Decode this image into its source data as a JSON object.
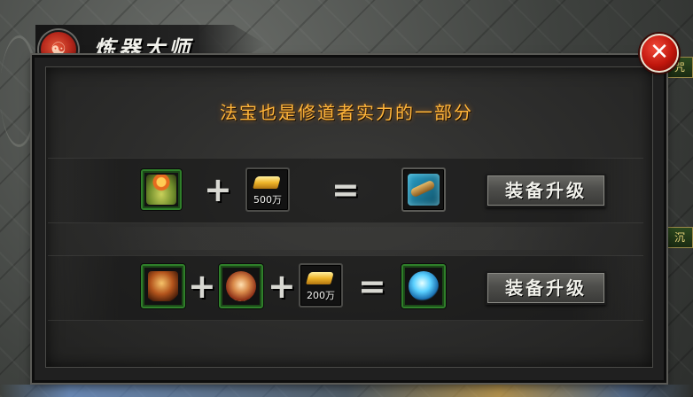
{
  "window": {
    "title": "炼器大师",
    "emblem_glyph": "☯",
    "close_glyph": "✕"
  },
  "subtitle": "法宝也是修道者实力的一部分",
  "plus_glyph": "+",
  "equals_glyph": "=",
  "recipes": [
    {
      "ingredients": [
        {
          "icon": "gourd-treasure-icon"
        },
        {
          "icon": "gold-ingot-icon",
          "label": "500万"
        }
      ],
      "result": {
        "icon": "cannon-treasure-icon"
      },
      "button_label": "装备升级"
    },
    {
      "ingredients": [
        {
          "icon": "bronze-orb-icon"
        },
        {
          "icon": "fire-orb-icon"
        },
        {
          "icon": "gold-ingot-icon",
          "label": "200万"
        }
      ],
      "result": {
        "icon": "blue-crystal-orb-icon"
      },
      "button_label": "装备升级"
    }
  ],
  "background": {
    "right_labels": [
      "咒",
      "沉"
    ]
  },
  "colors": {
    "subtitle": "#ffb53a",
    "close_button": "#c0160c",
    "item_border_green": "#2f7f2a",
    "panel": "#2c2c2b"
  }
}
